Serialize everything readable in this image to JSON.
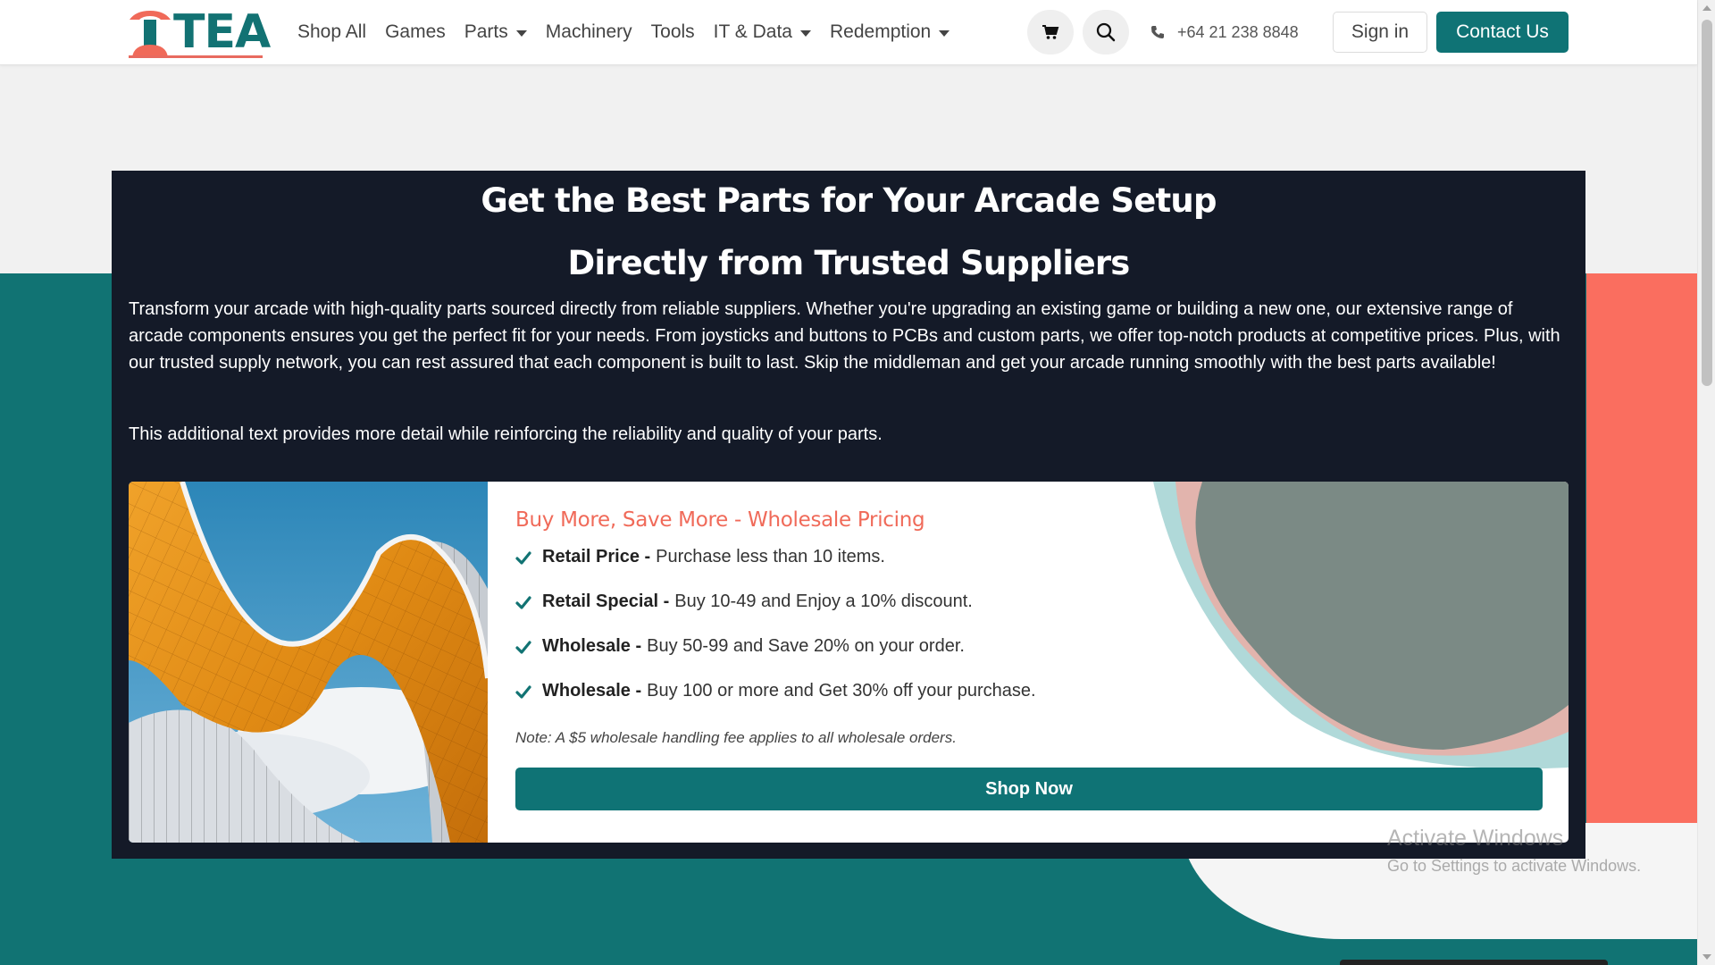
{
  "nav": {
    "logo_text": "TEA",
    "items": [
      {
        "label": "Shop All",
        "dropdown": false
      },
      {
        "label": "Games",
        "dropdown": false
      },
      {
        "label": "Parts",
        "dropdown": true
      },
      {
        "label": "Machinery",
        "dropdown": false
      },
      {
        "label": "Tools",
        "dropdown": false
      },
      {
        "label": "IT & Data",
        "dropdown": true
      },
      {
        "label": "Redemption",
        "dropdown": true
      }
    ],
    "cart_icon": "cart-icon",
    "search_icon": "search-icon",
    "phone": "+64 21 238 8848",
    "signin_label": "Sign in",
    "contact_label": "Contact Us"
  },
  "hero": {
    "title_line1": "Get the Best Parts for Your Arcade Setup",
    "title_line2": "Directly from Trusted Suppliers",
    "paragraph1": "Transform your arcade with high-quality parts sourced directly from reliable suppliers. Whether you're upgrading an existing game or building a new one, our extensive range of arcade components ensures you get the perfect fit for your needs. From joysticks and buttons to PCBs and custom parts, we offer top-notch products at competitive prices. Plus, with our trusted supply network, you can rest assured that each component is built to last. Skip the middleman and get your arcade running smoothly with the best parts available!",
    "paragraph2": "This additional text provides more detail while reinforcing the reliability and quality of your parts."
  },
  "pricing": {
    "title": "Buy More, Save More - Wholesale Pricing",
    "tiers": [
      {
        "name": "Retail Price -",
        "desc": "Purchase less than 10 items."
      },
      {
        "name": "Retail Special -",
        "desc": "Buy 10-49 and Enjoy a 10% discount."
      },
      {
        "name": "Wholesale -",
        "desc": "Buy 50-99 and Save 20% on your order."
      },
      {
        "name": "Wholesale -",
        "desc": "Buy 100 or more and Get 30% off your purchase."
      }
    ],
    "note": "Note: A $5 wholesale handling fee applies to all wholesale orders.",
    "button_label": "Shop Now"
  },
  "watermark": {
    "title": "Activate Windows",
    "subtitle": "Go to Settings to activate Windows."
  },
  "colors": {
    "teal": "#117373",
    "coral": "#fa6e5f",
    "dark": "#141a28",
    "title_coral": "#f06a59"
  }
}
